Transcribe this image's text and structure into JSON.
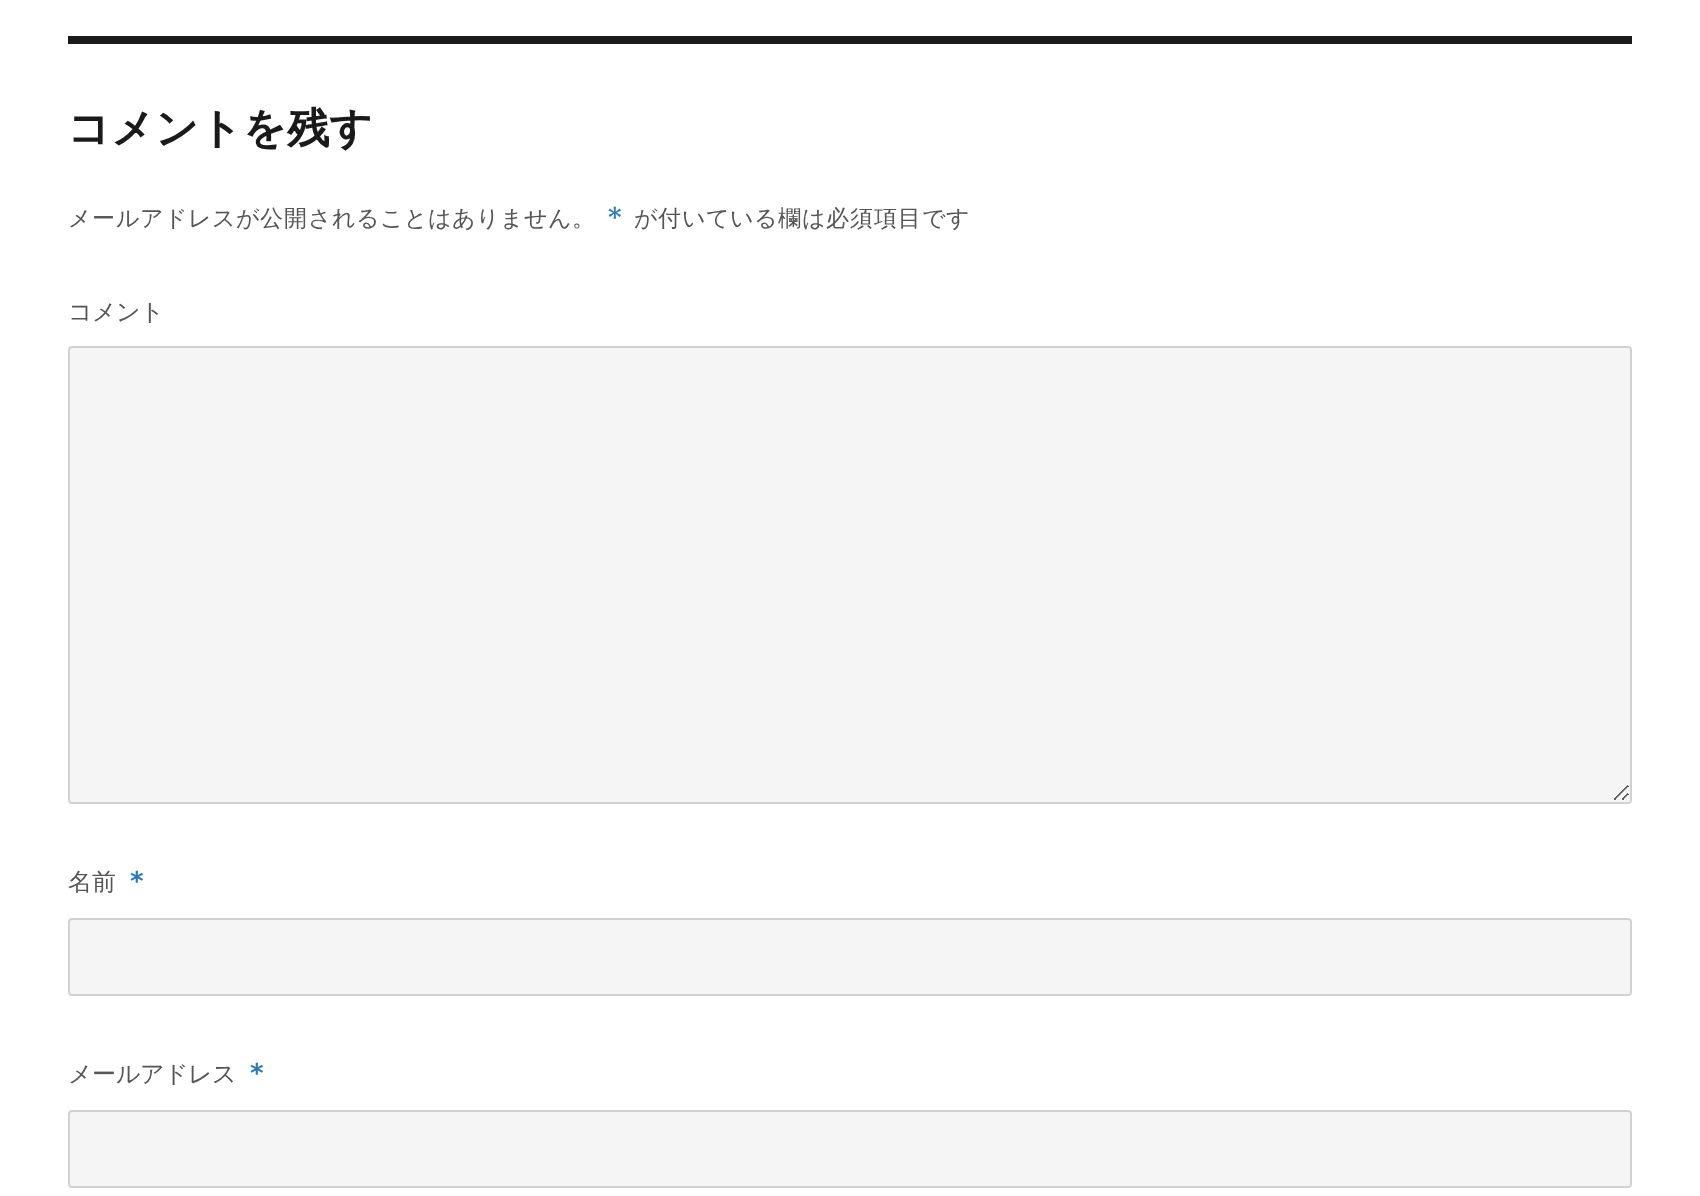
{
  "heading": "コメントを残す",
  "notice": {
    "text": "メールアドレスが公開されることはありません。",
    "mark": "*",
    "mark_text": "が付いている欄は必須項目です"
  },
  "fields": [
    {
      "kind": "textarea",
      "label": "コメント"
    },
    {
      "kind": "input",
      "label": "名前",
      "mark": "*"
    },
    {
      "kind": "input",
      "label": "メールアドレス",
      "mark": "*"
    }
  ]
}
